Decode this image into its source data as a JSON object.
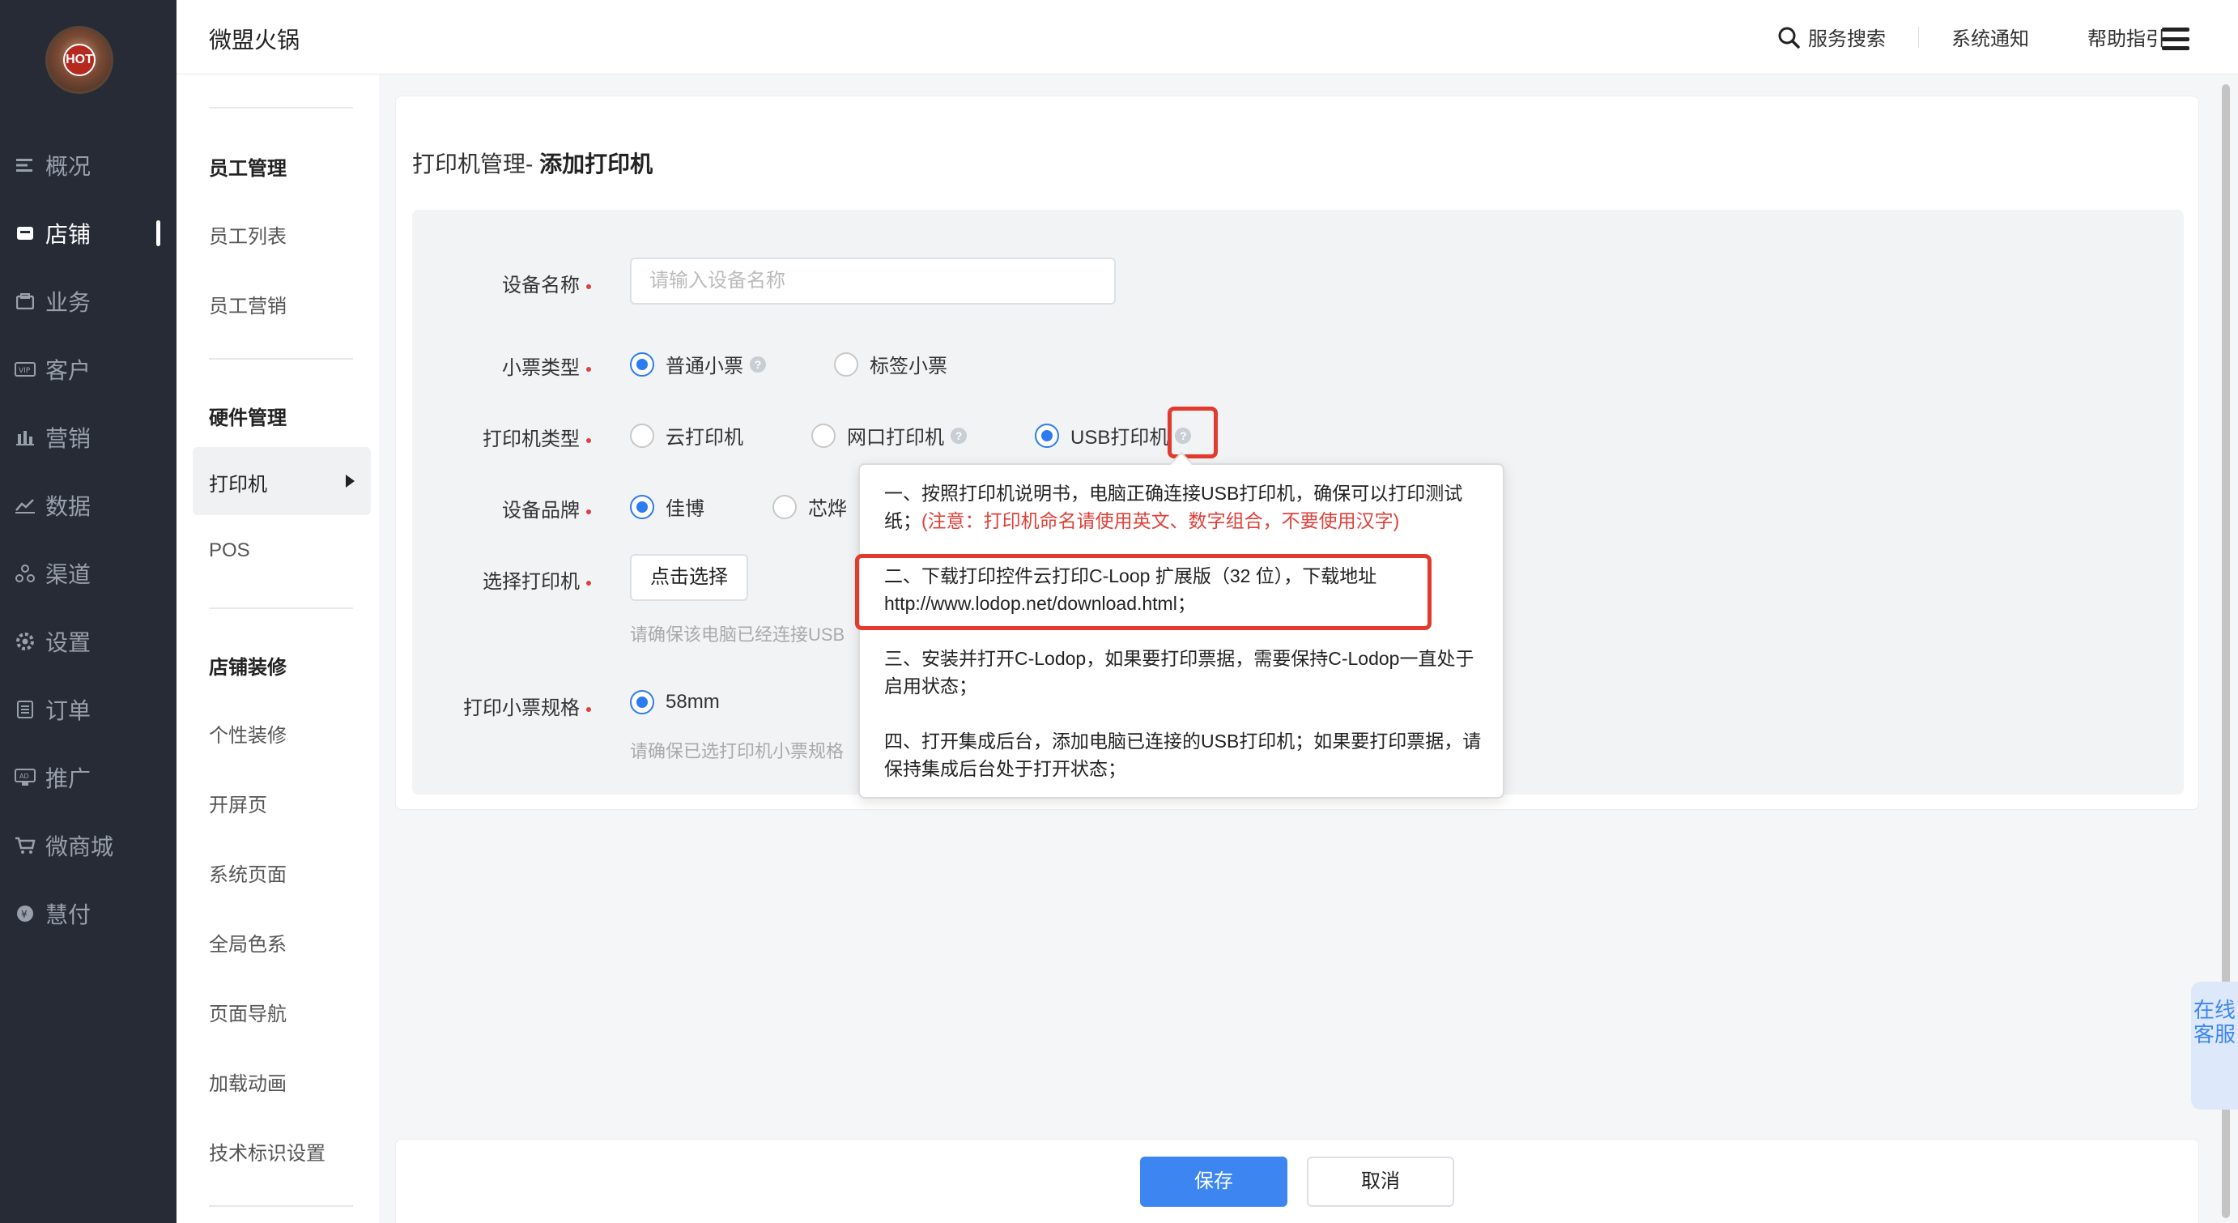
{
  "header": {
    "title": "微盟火锅",
    "search_label": "服务搜索",
    "notify_label": "系统通知",
    "help_label": "帮助指引"
  },
  "logo": {
    "text": "HOT"
  },
  "sidebar": {
    "items": [
      {
        "label": "概况",
        "icon": "overview-icon"
      },
      {
        "label": "店铺",
        "icon": "store-icon",
        "active": true
      },
      {
        "label": "业务",
        "icon": "business-icon"
      },
      {
        "label": "客户",
        "icon": "vip-icon"
      },
      {
        "label": "营销",
        "icon": "marketing-icon"
      },
      {
        "label": "数据",
        "icon": "data-icon"
      },
      {
        "label": "渠道",
        "icon": "channel-icon"
      },
      {
        "label": "设置",
        "icon": "settings-icon"
      },
      {
        "label": "订单",
        "icon": "order-icon"
      },
      {
        "label": "推广",
        "icon": "ad-icon"
      },
      {
        "label": "微商城",
        "icon": "cart-icon"
      },
      {
        "label": "慧付",
        "icon": "pay-icon"
      }
    ]
  },
  "subnav": {
    "groups": [
      {
        "title": "员工管理",
        "items": [
          "员工列表",
          "员工营销"
        ]
      },
      {
        "title": "硬件管理",
        "items": [
          "打印机",
          "POS"
        ]
      },
      {
        "title": "店铺装修",
        "items": [
          "个性装修",
          "开屏页",
          "系统页面",
          "全局色系",
          "页面导航",
          "加载动画",
          "技术标识设置"
        ]
      }
    ]
  },
  "page": {
    "breadcrumb": "打印机管理-",
    "title": "添加打印机"
  },
  "form": {
    "device_name": {
      "label": "设备名称",
      "placeholder": "请输入设备名称"
    },
    "ticket_type": {
      "label": "小票类型",
      "options": [
        "普通小票",
        "标签小票"
      ],
      "selected": "普通小票"
    },
    "printer_type": {
      "label": "打印机类型",
      "options": [
        "云打印机",
        "网口打印机",
        "USB打印机"
      ],
      "selected": "USB打印机"
    },
    "brand": {
      "label": "设备品牌",
      "options": [
        "佳博",
        "芯烨"
      ],
      "selected": "佳博"
    },
    "select_printer": {
      "label": "选择打印机",
      "button": "点击选择",
      "hint": "请确保该电脑已经连接USB"
    },
    "paper_spec": {
      "label": "打印小票规格",
      "options": [
        "58mm"
      ],
      "selected": "58mm",
      "hint": "请确保已选打印机小票规格"
    }
  },
  "tooltip": {
    "line1": "一、按照打印机说明书，电脑正确连接USB打印机，确保可以打印测试纸；",
    "line1_warn": "(注意：打印机命名请使用英文、数字组合，不要使用汉字)",
    "line2": "二、下载打印控件云打印C-Loop 扩展版（32 位），下载地址 http://www.lodop.net/download.html；",
    "line3": "三、安装并打开C-Lodop，如果要打印票据，需要保持C-Lodop一直处于启用状态；",
    "line4": "四、打开集成后台，添加电脑已连接的USB打印机；如果要打印票据，请保持集成后台处于打开状态；"
  },
  "actions": {
    "save": "保存",
    "cancel": "取消"
  },
  "service": {
    "label": "在线客服"
  },
  "colors": {
    "accent": "#3d86f1",
    "sidebar_bg": "#262b36",
    "highlight": "#e23b2e"
  }
}
